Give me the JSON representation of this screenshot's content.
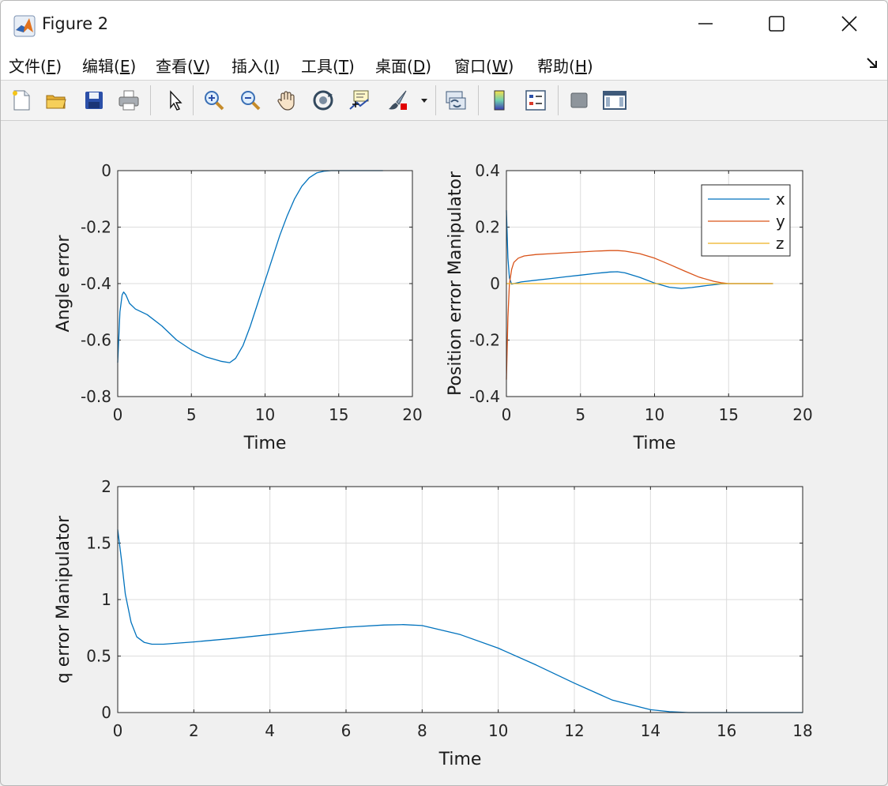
{
  "window": {
    "title": "Figure 2",
    "controls": [
      "minimize",
      "maximize",
      "close"
    ]
  },
  "menubar": {
    "items": [
      {
        "label": "文件(F)",
        "underline": "F"
      },
      {
        "label": "编辑(E)",
        "underline": "E"
      },
      {
        "label": "查看(V)",
        "underline": "V"
      },
      {
        "label": "插入(I)",
        "underline": "I"
      },
      {
        "label": "工具(T)",
        "underline": "T"
      },
      {
        "label": "桌面(D)",
        "underline": "D"
      },
      {
        "label": "窗口(W)",
        "underline": "W"
      },
      {
        "label": "帮助(H)",
        "underline": "H"
      }
    ]
  },
  "toolbar": {
    "icons": [
      "new-file-icon",
      "open-folder-icon",
      "save-icon",
      "print-icon",
      "pointer-icon",
      "zoom-in-icon",
      "zoom-out-icon",
      "pan-hand-icon",
      "rotate-3d-icon",
      "data-cursor-icon",
      "brush-icon",
      "link-plot-icon",
      "colorbar-icon",
      "legend-icon",
      "hide-plot-tools-icon",
      "show-plot-tools-icon"
    ]
  },
  "colors": {
    "x": "#0072BD",
    "y": "#D95319",
    "z": "#EDB120",
    "grid": "#dcdcdc",
    "axes": "#262626"
  },
  "chart_data": [
    {
      "type": "line",
      "ylabel": "Angle error",
      "xlabel": "Time",
      "xlim": [
        0,
        20
      ],
      "ylim": [
        -0.8,
        0
      ],
      "xticks": [
        "0",
        "5",
        "10",
        "15",
        "20"
      ],
      "yticks": [
        "0",
        "-0.2",
        "-0.4",
        "-0.6",
        "-0.8"
      ],
      "grid": true,
      "series": [
        {
          "x": [
            0,
            0.15,
            0.3,
            0.4,
            0.55,
            0.8,
            1.2,
            2,
            3,
            4,
            5,
            6,
            7,
            7.6,
            8,
            8.5,
            9,
            9.5,
            10,
            10.5,
            11,
            11.5,
            12,
            12.5,
            13,
            13.5,
            14,
            14.5,
            15,
            16,
            18
          ],
          "values": [
            -0.68,
            -0.5,
            -0.44,
            -0.43,
            -0.44,
            -0.47,
            -0.49,
            -0.51,
            -0.55,
            -0.6,
            -0.635,
            -0.66,
            -0.675,
            -0.68,
            -0.665,
            -0.62,
            -0.55,
            -0.47,
            -0.39,
            -0.31,
            -0.23,
            -0.16,
            -0.1,
            -0.055,
            -0.025,
            -0.008,
            -0.002,
            0,
            0,
            0,
            0
          ]
        }
      ]
    },
    {
      "type": "line",
      "ylabel": "Position error Manipulator",
      "xlabel": "Time",
      "xlim": [
        0,
        20
      ],
      "ylim": [
        -0.4,
        0.4
      ],
      "xticks": [
        "0",
        "5",
        "10",
        "15",
        "20"
      ],
      "yticks": [
        "0.4",
        "0.2",
        "0",
        "-0.2",
        "-0.4"
      ],
      "grid": true,
      "legend": {
        "position": "top-right",
        "entries": [
          "x",
          "y",
          "z"
        ]
      },
      "series": [
        {
          "name": "x",
          "x": [
            0,
            0.1,
            0.2,
            0.35,
            0.5,
            1,
            2,
            3,
            4,
            5,
            6,
            7,
            7.5,
            8,
            9,
            10,
            11,
            11.8,
            12.5,
            13.5,
            14.5,
            15,
            18
          ],
          "values": [
            0.26,
            0.09,
            0.02,
            -0.002,
            0.0,
            0.006,
            0.012,
            0.018,
            0.024,
            0.03,
            0.036,
            0.041,
            0.042,
            0.038,
            0.022,
            0.002,
            -0.013,
            -0.017,
            -0.014,
            -0.007,
            -0.001,
            0,
            0
          ]
        },
        {
          "name": "y",
          "x": [
            0,
            0.1,
            0.2,
            0.35,
            0.5,
            0.8,
            1.2,
            2,
            3,
            4,
            5,
            6,
            7,
            7.5,
            8,
            9,
            10,
            11,
            12,
            13,
            14,
            14.5,
            15,
            18
          ],
          "values": [
            -0.34,
            -0.12,
            0.0,
            0.05,
            0.075,
            0.09,
            0.098,
            0.103,
            0.106,
            0.109,
            0.112,
            0.115,
            0.117,
            0.117,
            0.115,
            0.106,
            0.09,
            0.068,
            0.045,
            0.023,
            0.008,
            0.003,
            0,
            0
          ]
        },
        {
          "name": "z",
          "x": [
            0,
            18
          ],
          "values": [
            0,
            0
          ]
        }
      ]
    },
    {
      "type": "line",
      "ylabel": "q error Manipulator",
      "xlabel": "Time",
      "xlim": [
        0,
        18
      ],
      "ylim": [
        0,
        2
      ],
      "xticks": [
        "0",
        "2",
        "4",
        "6",
        "8",
        "10",
        "12",
        "14",
        "16",
        "18"
      ],
      "yticks": [
        "2",
        "1.5",
        "1",
        "0.5",
        "0"
      ],
      "grid": true,
      "series": [
        {
          "x": [
            0,
            0.1,
            0.2,
            0.35,
            0.5,
            0.7,
            0.9,
            1.2,
            2,
            3,
            4,
            5,
            6,
            7,
            7.5,
            8,
            9,
            10,
            11,
            12,
            13,
            14,
            14.5,
            15,
            16,
            18
          ],
          "values": [
            1.62,
            1.35,
            1.05,
            0.8,
            0.67,
            0.62,
            0.605,
            0.605,
            0.625,
            0.655,
            0.69,
            0.725,
            0.755,
            0.775,
            0.778,
            0.77,
            0.69,
            0.57,
            0.42,
            0.26,
            0.11,
            0.025,
            0.008,
            0,
            0,
            0
          ]
        }
      ]
    }
  ]
}
